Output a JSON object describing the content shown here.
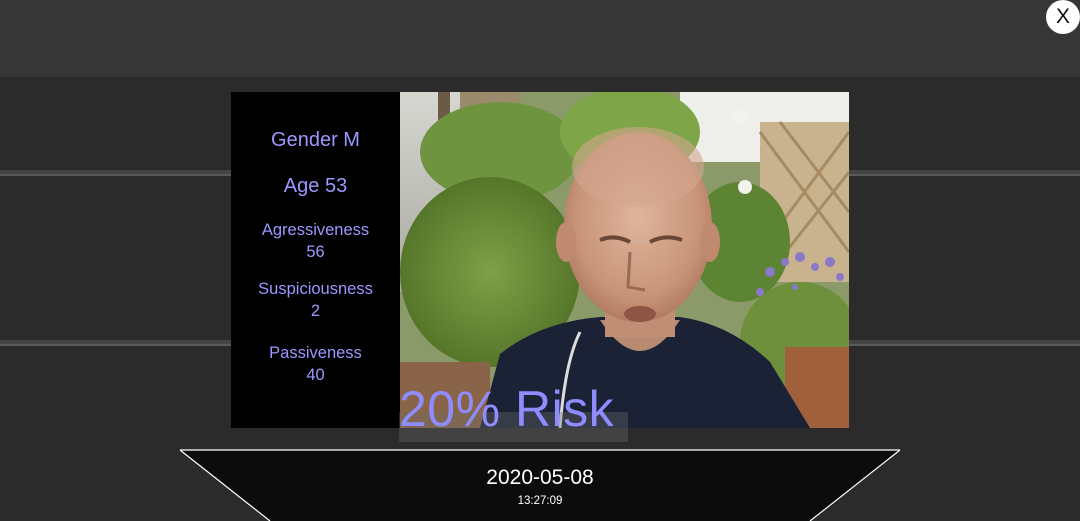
{
  "header": {
    "close_label": "X"
  },
  "profile": {
    "gender": "Gender M",
    "age": "Age 53",
    "stats": [
      {
        "label": "Agressiveness",
        "value": "56"
      },
      {
        "label": "Suspiciousness",
        "value": "2"
      },
      {
        "label": "Passiveness",
        "value": "40"
      }
    ]
  },
  "risk": {
    "label": "20% Risk"
  },
  "timestamp": {
    "date": "2020-05-08",
    "time": "13:27:09"
  },
  "colors": {
    "accent": "#9c98ff",
    "background": "#2b2b2b",
    "panel": "#000000"
  }
}
